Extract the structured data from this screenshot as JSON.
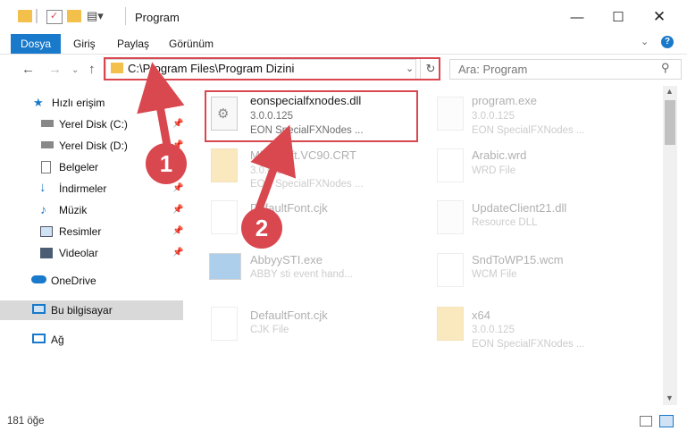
{
  "window": {
    "title": "Program"
  },
  "ribbon": {
    "tabs": [
      "Dosya",
      "Giriş",
      "Paylaş",
      "Görünüm"
    ]
  },
  "address": {
    "path": "C:\\Program Files\\Program Dizini"
  },
  "search": {
    "placeholder": "Ara: Program"
  },
  "sidebar": {
    "items": [
      {
        "label": "Hızlı erişim",
        "icon": "star-icon"
      },
      {
        "label": "Yerel Disk (C:)",
        "icon": "drive-icon",
        "pinned": true
      },
      {
        "label": "Yerel Disk (D:)",
        "icon": "drive-icon",
        "pinned": true
      },
      {
        "label": "Belgeler",
        "icon": "document-icon",
        "pinned": true
      },
      {
        "label": "İndirmeler",
        "icon": "download-icon",
        "pinned": true
      },
      {
        "label": "Müzik",
        "icon": "music-icon",
        "pinned": true
      },
      {
        "label": "Resimler",
        "icon": "pictures-icon",
        "pinned": true
      },
      {
        "label": "Videolar",
        "icon": "video-icon",
        "pinned": true
      },
      {
        "label": "OneDrive",
        "icon": "cloud-icon"
      },
      {
        "label": "Bu bilgisayar",
        "icon": "computer-icon",
        "selected": true
      },
      {
        "label": "Ağ",
        "icon": "network-icon"
      }
    ]
  },
  "files": [
    {
      "name": "eonspecialfxnodes.dll",
      "line2": "3.0.0.125",
      "line3": "EON SpecialFXNodes ...",
      "highlighted": true
    },
    {
      "name": "program.exe",
      "line2": "3.0.0.125",
      "line3": "EON SpecialFXNodes ..."
    },
    {
      "name": "Microsoft.VC90.CRT",
      "line2": "3.0.0.125",
      "line3": "EON SpecialFXNodes ..."
    },
    {
      "name": "Arabic.wrd",
      "line2": "WRD File",
      "line3": ""
    },
    {
      "name": "DefaultFont.cjk",
      "line2": "",
      "line3": ""
    },
    {
      "name": "UpdateClient21.dll",
      "line2": "Resource DLL",
      "line3": ""
    },
    {
      "name": "AbbyySTI.exe",
      "line2": "ABBY sti event hand...",
      "line3": ""
    },
    {
      "name": "SndToWP15.wcm",
      "line2": "WCM File",
      "line3": ""
    },
    {
      "name": "DefaultFont.cjk",
      "line2": "CJK File",
      "line3": ""
    },
    {
      "name": "x64",
      "line2": "3.0.0.125",
      "line3": "EON SpecialFXNodes ..."
    }
  ],
  "annotations": {
    "badge1": "1",
    "badge2": "2"
  },
  "status": {
    "count": "181 öğe"
  },
  "colors": {
    "accent": "#1979ca",
    "highlight": "#d9474f"
  }
}
